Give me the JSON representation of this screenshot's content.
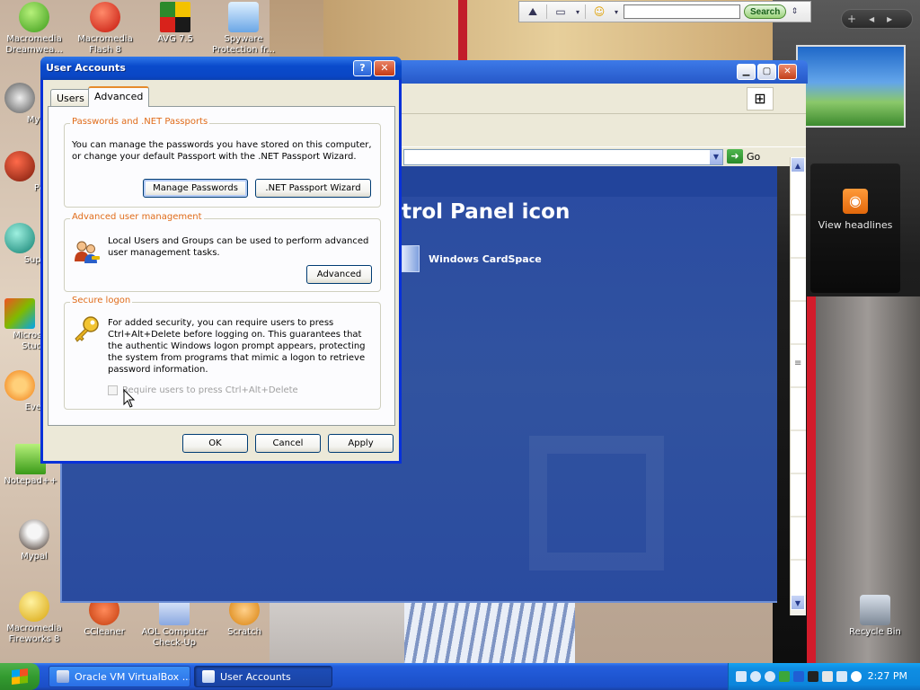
{
  "desktop_icons": [
    {
      "name": "dreamweaver",
      "label": "Macromedia Dreamwea..."
    },
    {
      "name": "flash",
      "label": "Macromedia Flash 8"
    },
    {
      "name": "avg",
      "label": "AVG 7.5"
    },
    {
      "name": "spyware",
      "label": "Spyware Protection fr..."
    },
    {
      "name": "mypal",
      "label": "MyPa"
    },
    {
      "name": "peg",
      "label": "Peg"
    },
    {
      "name": "super",
      "label": "Super"
    },
    {
      "name": "msstudio",
      "label": "Microsof Studio"
    },
    {
      "name": "every",
      "label": "Every"
    },
    {
      "name": "notepadpp",
      "label": "Notepad++"
    },
    {
      "name": "mypal2",
      "label": "Mypal"
    },
    {
      "name": "fireworks",
      "label": "Macromedia Fireworks 8"
    },
    {
      "name": "ccleaner",
      "label": "CCleaner"
    },
    {
      "name": "aol",
      "label": "AOL Computer Check-Up"
    },
    {
      "name": "scratch",
      "label": "Scratch"
    },
    {
      "name": "recycle",
      "label": "Recycle Bin"
    }
  ],
  "google_toolbar": {
    "search_value": "",
    "search_button": "Search"
  },
  "gadgets": {
    "feeds_label": "View headlines"
  },
  "control_panel": {
    "heading": "trol Panel icon",
    "cardspace_label": "Windows CardSpace",
    "go_label": "Go"
  },
  "dialog": {
    "title": "User Accounts",
    "help_button": "?",
    "close_button": "✕",
    "tabs": [
      {
        "label": "Users"
      },
      {
        "label": "Advanced"
      }
    ],
    "passwords": {
      "title": "Passwords and .NET Passports",
      "text": "You can manage the passwords you have stored on this computer, or change your default Passport with the .NET Passport Wizard.",
      "manage_button": "Manage Passwords",
      "passport_button": ".NET Passport Wizard"
    },
    "advanced": {
      "title": "Advanced user management",
      "text": "Local Users and Groups can be used to perform advanced user management tasks.",
      "button": "Advanced"
    },
    "secure": {
      "title": "Secure logon",
      "text": "For added security, you can require users to press Ctrl+Alt+Delete before logging on. This guarantees that the authentic Windows logon prompt appears, protecting the system from programs that mimic a logon to retrieve password information.",
      "checkbox_label": "Require users to press Ctrl+Alt+Delete",
      "checkbox_checked": false,
      "checkbox_enabled": false
    },
    "ok_button": "OK",
    "cancel_button": "Cancel",
    "apply_button": "Apply"
  },
  "taskbar": {
    "tasks": [
      {
        "label": "Oracle VM VirtualBox ..."
      },
      {
        "label": "User Accounts"
      }
    ],
    "clock": "2:27 PM"
  },
  "colors": {
    "group_title": "#e06c1a",
    "title_bar": "#0a4bcc",
    "taskbar": "#245edc",
    "start": "#339b30"
  }
}
